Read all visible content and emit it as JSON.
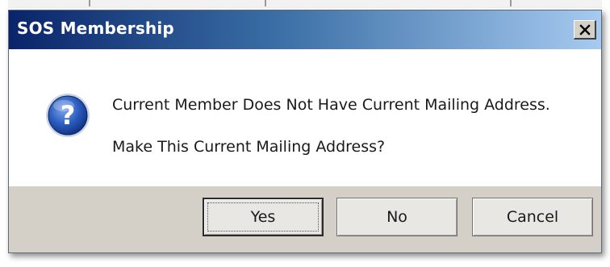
{
  "window": {
    "title": "SOS Membership",
    "close_icon": "close-icon"
  },
  "message": {
    "icon": "question-icon",
    "line1": "Current Member Does Not Have Current Mailing Address.",
    "line2": "Make This Current Mailing Address?"
  },
  "buttons": {
    "yes_label": "Yes",
    "no_label": "No",
    "cancel_label": "Cancel",
    "default": "Yes"
  },
  "colors": {
    "titlebar_start": "#0a246a",
    "titlebar_end": "#a6caf0",
    "face": "#d4d0c8",
    "icon_blue": "#1f4fa8"
  }
}
